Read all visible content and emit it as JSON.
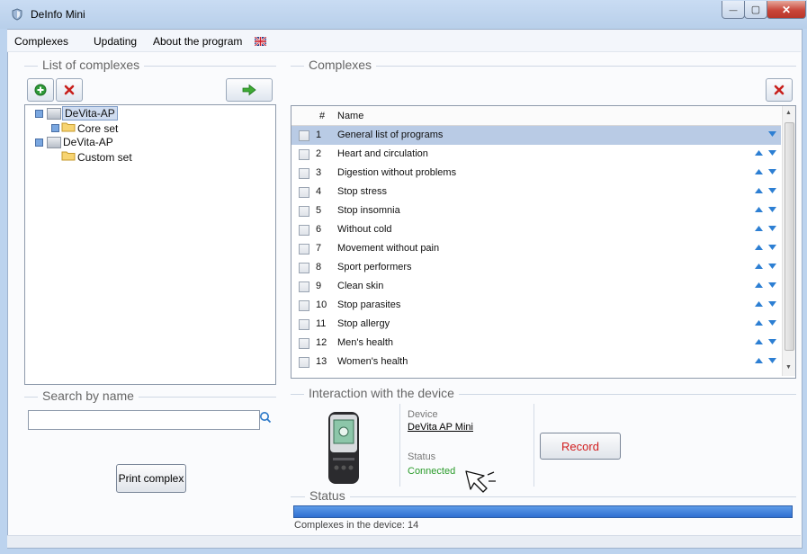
{
  "window": {
    "title": "DeInfo Mini",
    "controls": {
      "minimize": "—",
      "maximize": "▢",
      "close": "✕"
    }
  },
  "menu": {
    "items": [
      "Complexes",
      "Updating",
      "About the program"
    ],
    "language_flag": "uk-flag-icon"
  },
  "left": {
    "list_title": "List of complexes",
    "tree": [
      {
        "label": "DeVita-AP",
        "selected": true
      },
      {
        "label": "Core set"
      },
      {
        "label": "DeVita-AP"
      },
      {
        "label": "Custom set"
      }
    ],
    "search_title": "Search by name",
    "search_value": "",
    "print_label": "Print complex"
  },
  "right": {
    "complexes_title": "Complexes",
    "grid": {
      "col_num": "#",
      "col_name": "Name",
      "rows": [
        {
          "num": "1",
          "name": "General list of programs",
          "selected": true
        },
        {
          "num": "2",
          "name": "Heart and circulation"
        },
        {
          "num": "3",
          "name": "Digestion without problems"
        },
        {
          "num": "4",
          "name": "Stop stress"
        },
        {
          "num": "5",
          "name": "Stop insomnia"
        },
        {
          "num": "6",
          "name": "Without cold"
        },
        {
          "num": "7",
          "name": "Movement without pain"
        },
        {
          "num": "8",
          "name": "Sport performers"
        },
        {
          "num": "9",
          "name": "Clean skin"
        },
        {
          "num": "10",
          "name": "Stop parasites"
        },
        {
          "num": "11",
          "name": "Stop allergy"
        },
        {
          "num": "12",
          "name": "Men's health"
        },
        {
          "num": "13",
          "name": "Women's health"
        }
      ]
    },
    "interaction_title": "Interaction with the device",
    "device_label": "Device",
    "device_name": "DeVita AP Mini",
    "status_label": "Status",
    "status_value": "Connected",
    "record_label": "Record",
    "status_title": "Status",
    "status_progress": 1.0,
    "complexes_count_text": "Complexes in the device: 14"
  },
  "colors": {
    "accent": "#2f6fd1",
    "connected": "#2a9b2a",
    "record_text": "#d21e1e",
    "selected_row": "#b9cbe5"
  }
}
